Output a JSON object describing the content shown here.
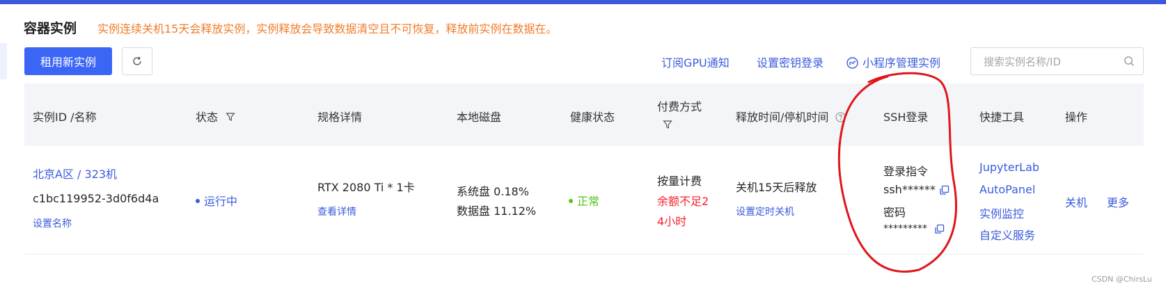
{
  "header": {
    "title": "容器实例",
    "notice": "实例连续关机15天会释放实例，实例释放会导致数据清空且不可恢复，释放前实例在数据在。"
  },
  "toolbar": {
    "new_instance": "租用新实例",
    "links": {
      "subscribe_gpu": "订阅GPU通知",
      "set_key_login": "设置密钥登录",
      "miniprogram": "小程序管理实例"
    },
    "search": {
      "placeholder": "搜索实例名称/ID",
      "value": ""
    }
  },
  "table": {
    "headers": {
      "id_name": "实例ID /名称",
      "status": "状态",
      "spec": "规格详情",
      "disk": "本地磁盘",
      "health": "健康状态",
      "billing": "付费方式",
      "release": "释放时间/停机时间",
      "ssh": "SSH登录",
      "tools": "快捷工具",
      "ops": "操作"
    },
    "row": {
      "region_name": "北京A区 / 323机",
      "instance_id": "c1bc119952-3d0f6d4a",
      "set_name": "设置名称",
      "status": "运行中",
      "gpu": "RTX 2080 Ti * 1卡",
      "view_details": "查看详情",
      "system_disk": "系统盘 0.18%",
      "data_disk": "数据盘 11.12%",
      "health": "正常",
      "billing_type": "按量计费",
      "billing_warn_1": "余额不足2",
      "billing_warn_2": "4小时",
      "release_info": "关机15天后释放",
      "scheduled_shutdown": "设置定时关机",
      "ssh_cmd_label": "登录指令",
      "ssh_cmd": "ssh******",
      "password_label": "密码",
      "password": "*********",
      "tools": [
        "JupyterLab",
        "AutoPanel",
        "实例监控",
        "自定义服务"
      ],
      "shutdown": "关机",
      "more": "更多"
    }
  },
  "colors": {
    "accent": "#3b5bdb",
    "primary_button": "#3b66f5",
    "notice": "#f07c2a",
    "ok": "#52c41a",
    "warn": "#f5222d",
    "annotation": "#e0151b"
  },
  "watermark": "CSDN @ChirsLu"
}
